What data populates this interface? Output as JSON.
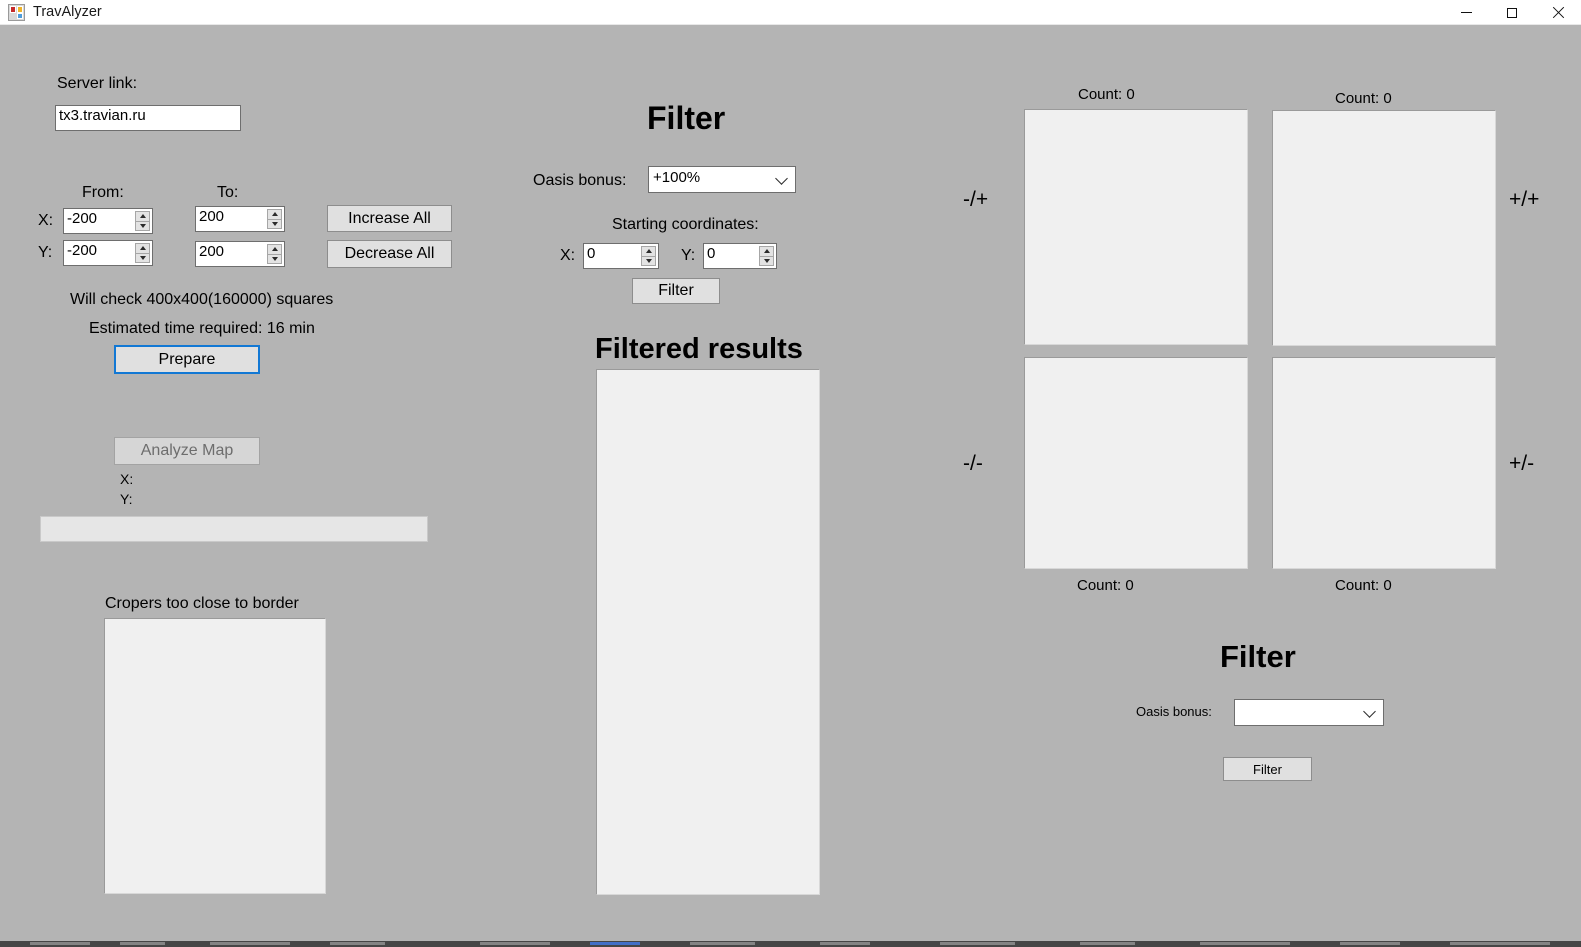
{
  "window": {
    "title": "TravAlyzer",
    "icon": "winforms-designer-icon",
    "controls": {
      "minimize": "minimize-icon",
      "maximize": "maximize-icon",
      "close": "close-icon"
    }
  },
  "left_panel": {
    "server_link_label": "Server link:",
    "server_link_value": "tx3.travian.ru",
    "from_label": "From:",
    "to_label": "To:",
    "x_label": "X:",
    "y_label": "Y:",
    "x_from": "-200",
    "x_to": "200",
    "y_from": "-200",
    "y_to": "200",
    "increase_all": "Increase All",
    "decrease_all": "Decrease All",
    "will_check_text": "Will check 400x400(160000) squares",
    "estimated_time_text": "Estimated time required: 16 min",
    "prepare_button": "Prepare",
    "analyze_map_button": "Analyze Map",
    "progress_x_label": "X:",
    "progress_y_label": "Y:",
    "progress_value": "",
    "cropers_label": "Cropers too close to border",
    "cropers_items": []
  },
  "center_panel": {
    "filter_heading": "Filter",
    "oasis_bonus_label": "Oasis bonus:",
    "oasis_bonus_value": "+100%",
    "oasis_bonus_options": [
      "+100%"
    ],
    "starting_coordinates_label": "Starting coordinates:",
    "start_x_label": "X:",
    "start_x_value": "0",
    "start_y_label": "Y:",
    "start_y_value": "0",
    "filter_button": "Filter",
    "filtered_results_heading": "Filtered results",
    "filtered_results_items": []
  },
  "right_panel": {
    "quadrants": [
      {
        "name": "minus-plus",
        "label": "-/+",
        "count_text": "Count: 0",
        "count_position": "top",
        "items": []
      },
      {
        "name": "plus-plus",
        "label": "+/+",
        "count_text": "Count: 0",
        "count_position": "top",
        "items": []
      },
      {
        "name": "minus-minus",
        "label": "-/-",
        "count_text": "Count: 0",
        "count_position": "bottom",
        "items": []
      },
      {
        "name": "plus-minus",
        "label": "+/-",
        "count_text": "Count: 0",
        "count_position": "bottom",
        "items": []
      }
    ],
    "filter_heading": "Filter",
    "oasis_bonus_label": "Oasis bonus:",
    "oasis_bonus_value": "",
    "oasis_bonus_options": [],
    "filter_button": "Filter"
  },
  "colors": {
    "window_background": "#b4b4b4",
    "titlebar_background": "#ffffff",
    "listbox_background": "#f0f0f0",
    "focus_border": "#1278d4",
    "button_face": "#e0e0e0"
  }
}
